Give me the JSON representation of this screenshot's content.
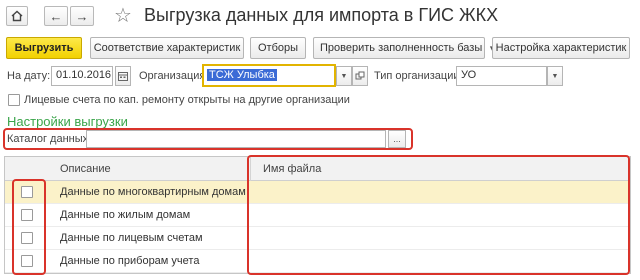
{
  "header": {
    "title": "Выгрузка данных для импорта в ГИС ЖКХ"
  },
  "toolbar": {
    "upload": "Выгрузить",
    "mapping": "Соответствие характеристик",
    "filters": "Отборы",
    "check_base": "Проверить заполненность базы",
    "settings": "Настройка характеристик"
  },
  "fields": {
    "date_label": "На дату:",
    "date_value": "01.10.2016",
    "org_label": "Организация:",
    "org_value": "ТСЖ Улыбка",
    "org_type_label": "Тип организации:",
    "org_type_value": "УО",
    "checkbox_label": "Лицевые счета по кап. ремонту открыты на другие организации"
  },
  "section": {
    "title": "Настройки выгрузки",
    "catalog_label": "Каталог данных:",
    "catalog_value": ""
  },
  "table": {
    "columns": [
      "Описание",
      "Имя файла"
    ],
    "rows": [
      {
        "description": "Данные по многоквартирным домам",
        "file": ""
      },
      {
        "description": "Данные по жилым домам",
        "file": ""
      },
      {
        "description": "Данные по лицевым счетам",
        "file": ""
      },
      {
        "description": "Данные по приборам учета",
        "file": ""
      }
    ]
  },
  "colors": {
    "accent_button": "#f2d100",
    "section_title": "#3aa54a",
    "highlight_box": "#d9332a",
    "selected_row": "#fbf2c9",
    "selected_text": "#3b6bd6"
  }
}
